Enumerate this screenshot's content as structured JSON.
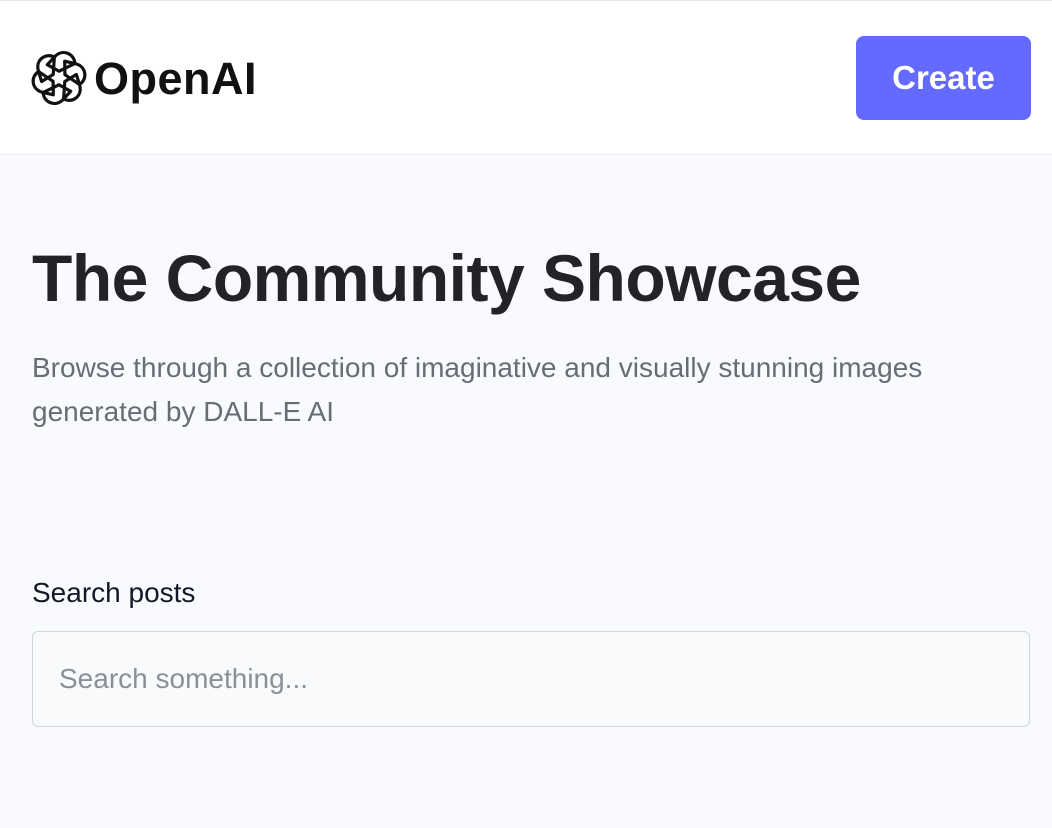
{
  "header": {
    "brand_name": "OpenAI",
    "logo_icon": "openai-logo-icon",
    "create_label": "Create",
    "accent_color": "#6469ff"
  },
  "hero": {
    "title": "The Community Showcase",
    "subtitle": "Browse through a collection of imaginative and visually stunning images generated by DALL-E AI"
  },
  "search": {
    "label": "Search posts",
    "placeholder": "Search something...",
    "value": ""
  }
}
